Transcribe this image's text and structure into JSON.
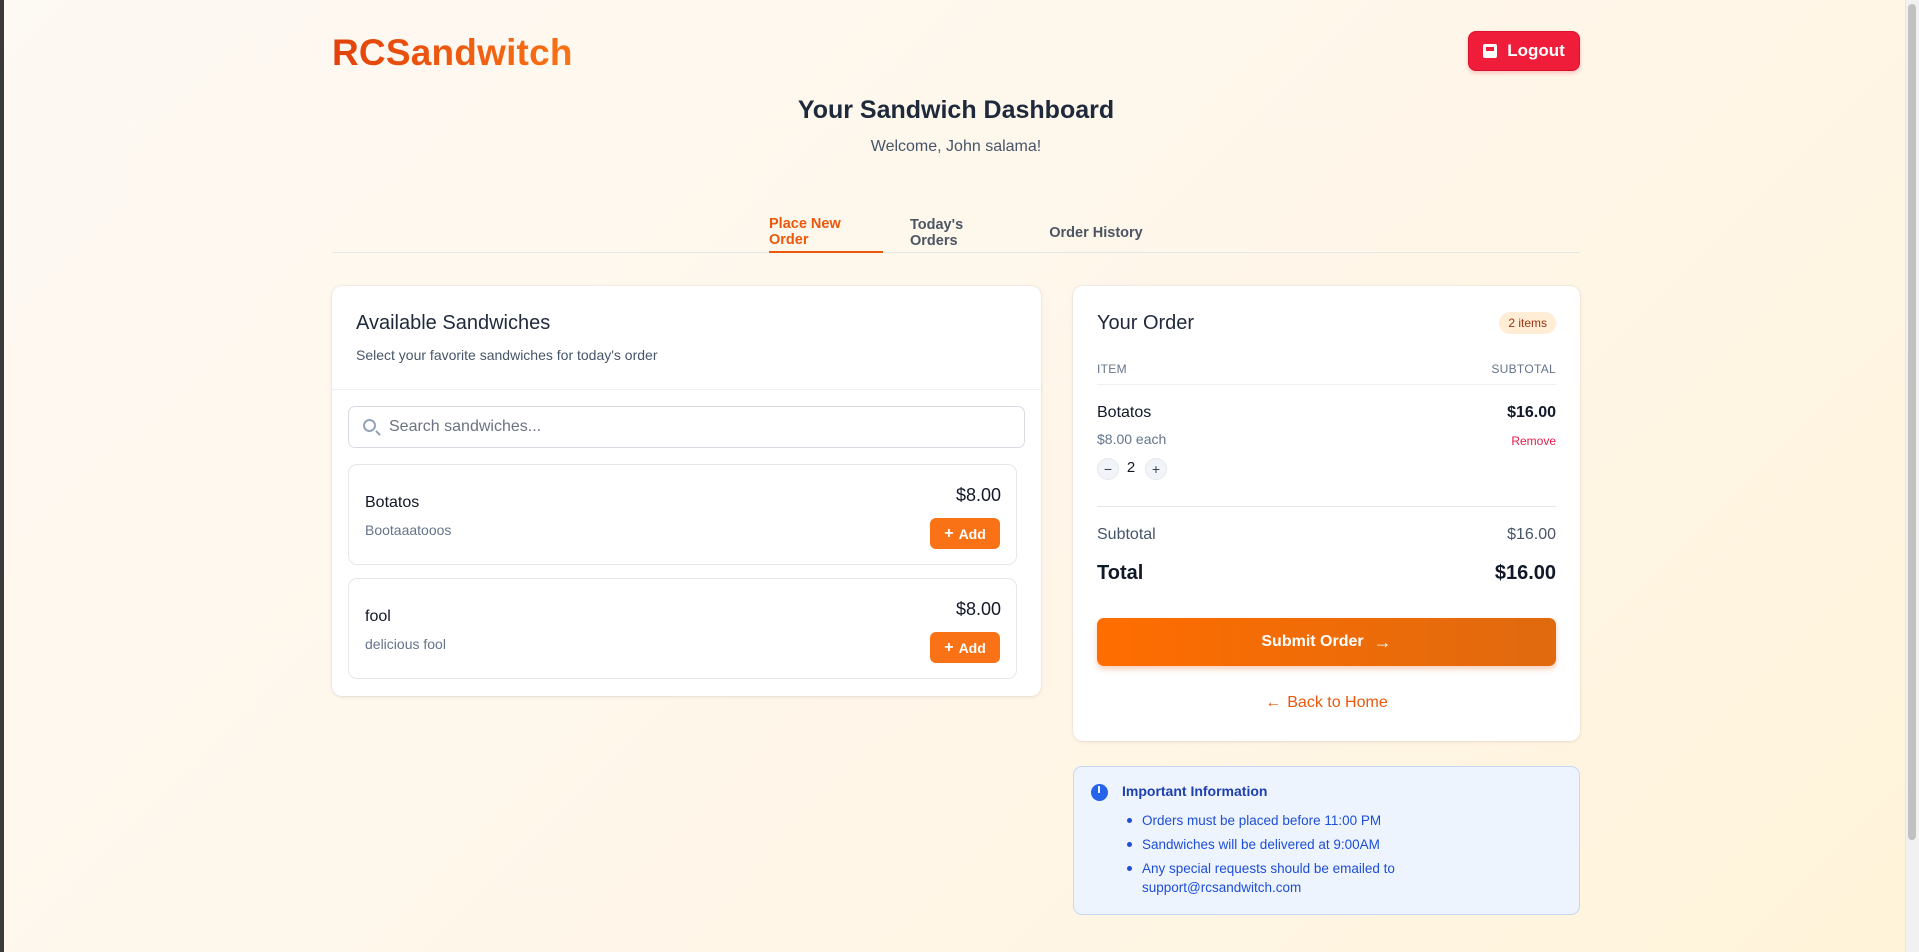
{
  "header": {
    "brand": "RCSandwitch",
    "logout_label": "Logout"
  },
  "page": {
    "title": "Your Sandwich Dashboard",
    "welcome": "Welcome, John salama!"
  },
  "tabs": [
    {
      "label": "Place New Order",
      "active": true
    },
    {
      "label": "Today's Orders",
      "active": false
    },
    {
      "label": "Order History",
      "active": false
    }
  ],
  "available": {
    "title": "Available Sandwiches",
    "subtitle": "Select your favorite sandwiches for today's order",
    "search_placeholder": "Search sandwiches...",
    "add_label": "Add",
    "items": [
      {
        "name": "Botatos",
        "description": "Bootaaatooos",
        "price": "$8.00"
      },
      {
        "name": "fool",
        "description": "delicious fool",
        "price": "$8.00"
      }
    ]
  },
  "order": {
    "title": "Your Order",
    "badge": "2 items",
    "col_item": "ITEM",
    "col_subtotal": "SUBTOTAL",
    "lines": [
      {
        "name": "Botatos",
        "each": "$8.00 each",
        "subtotal": "$16.00",
        "remove": "Remove",
        "qty": "2"
      }
    ],
    "subtotal_label": "Subtotal",
    "subtotal_value": "$16.00",
    "total_label": "Total",
    "total_value": "$16.00",
    "submit_label": "Submit Order",
    "back_label": "Back to Home"
  },
  "info": {
    "title": "Important Information",
    "items": [
      "Orders must be placed before 11:00 PM",
      "Sandwiches will be delivered at 9:00AM",
      "Any special requests should be emailed to support@rcsandwitch.com"
    ]
  },
  "colors": {
    "accent": "#ea580c",
    "button_orange": "#f97316",
    "logout_red": "#ef1d3a",
    "info_blue": "#1d4ed8"
  },
  "icons": [
    "logout-icon",
    "search-icon",
    "plus-icon",
    "minus-icon",
    "arrow-right-icon",
    "arrow-left-icon",
    "info-icon"
  ]
}
